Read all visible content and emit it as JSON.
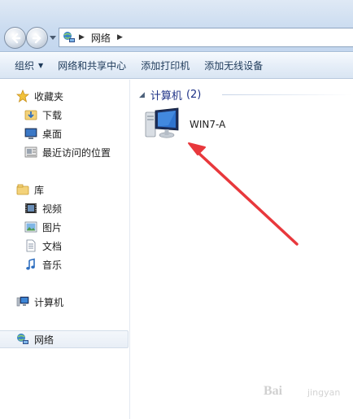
{
  "address": {
    "location": "网络",
    "icon": "network-icon"
  },
  "toolbar": {
    "organize_label": "组织",
    "network_center_label": "网络和共享中心",
    "add_printer_label": "添加打印机",
    "add_wireless_label": "添加无线设备"
  },
  "sidebar": {
    "favorites": {
      "label": "收藏夹",
      "icon": "star-icon",
      "items": [
        {
          "label": "下载",
          "icon": "download-folder-icon"
        },
        {
          "label": "桌面",
          "icon": "desktop-icon"
        },
        {
          "label": "最近访问的位置",
          "icon": "recent-places-icon"
        }
      ]
    },
    "libraries": {
      "label": "库",
      "icon": "library-icon",
      "items": [
        {
          "label": "视频",
          "icon": "video-icon"
        },
        {
          "label": "图片",
          "icon": "picture-icon"
        },
        {
          "label": "文档",
          "icon": "document-icon"
        },
        {
          "label": "音乐",
          "icon": "music-icon"
        }
      ]
    },
    "computer": {
      "label": "计算机",
      "icon": "computer-icon"
    },
    "network": {
      "label": "网络",
      "icon": "network-icon",
      "selected": true
    }
  },
  "main": {
    "group_title": "计算机",
    "group_count": "(2)",
    "items": [
      {
        "name": "WIN7-A",
        "icon": "computer-icon"
      }
    ]
  },
  "annotation": {
    "color": "#e8383c",
    "icon": "red-arrow-annotation"
  },
  "watermark": {
    "text": "Bai",
    "sub": "jingyan"
  },
  "colors": {
    "accent": "#1e3287",
    "selection": "#e8eef6",
    "toolbar_text": "#1e3a5a"
  }
}
